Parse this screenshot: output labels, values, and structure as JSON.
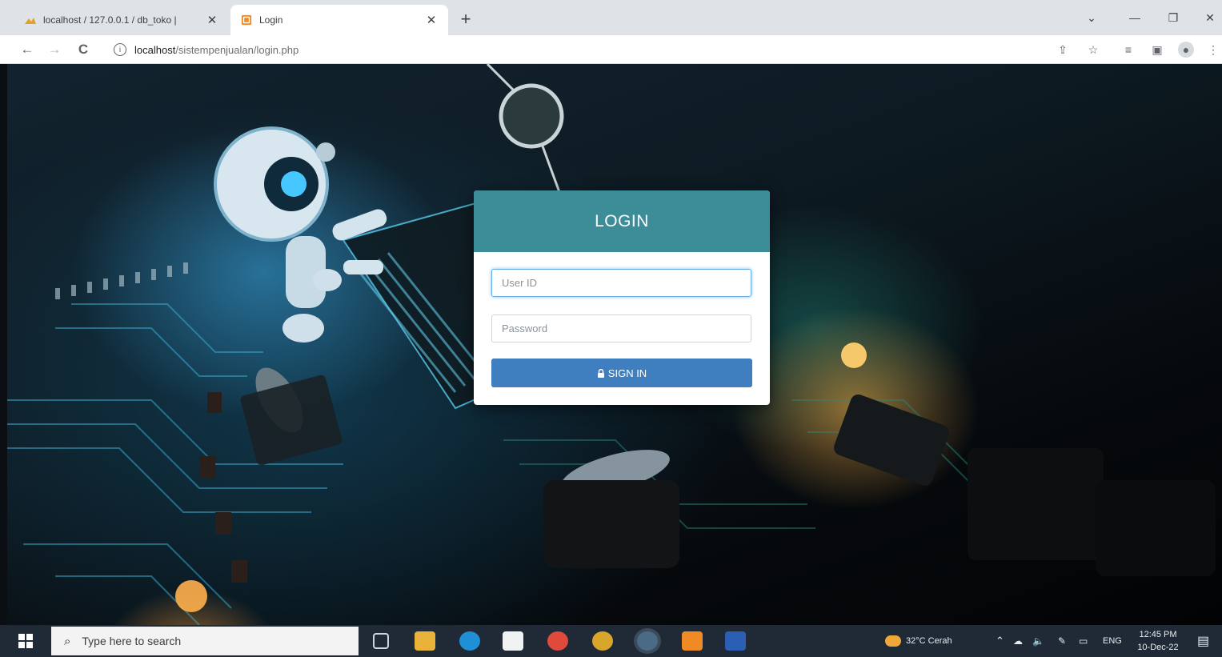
{
  "browser": {
    "tabs": [
      {
        "title": "localhost / 127.0.0.1 / db_toko | ",
        "active": false
      },
      {
        "title": "Login",
        "active": true
      }
    ],
    "close_glyph": "✕",
    "new_tab_glyph": "+",
    "window_controls": {
      "dropdown": "⌄",
      "minimize": "—",
      "restore": "❐",
      "close": "✕"
    },
    "url": {
      "host": "localhost",
      "path": "/sistempenjualan/login.php"
    },
    "nav": {
      "back": "←",
      "forward": "→",
      "reload": "C"
    }
  },
  "login": {
    "title": "LOGIN",
    "userid_placeholder": "User ID",
    "password_placeholder": "Password",
    "signin_label": "SIGN IN",
    "header_color": "#3d8d98",
    "button_color": "#3f7fbf"
  },
  "taskbar": {
    "search_placeholder": "Type here to search",
    "weather": "32°C  Cerah",
    "language": "ENG",
    "time": "12:45 PM",
    "date": "10-Dec-22"
  }
}
